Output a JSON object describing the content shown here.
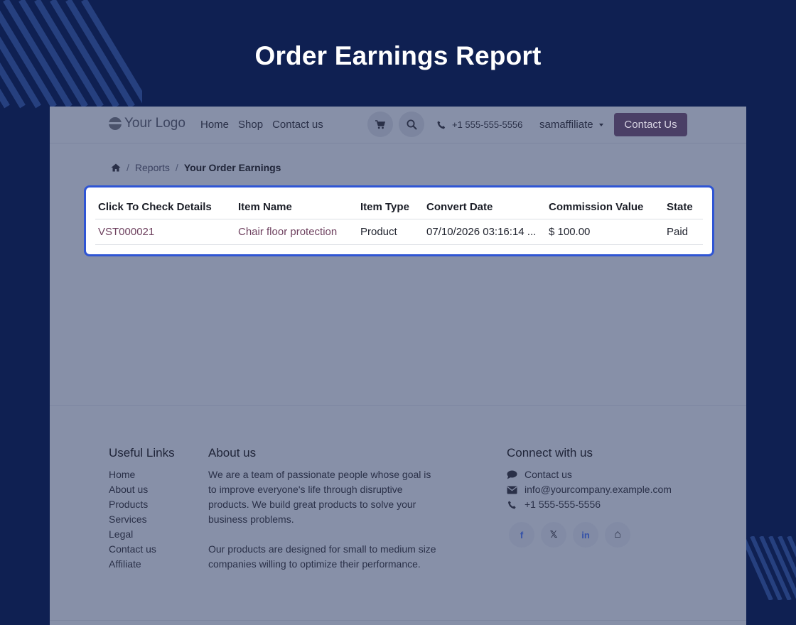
{
  "banner": {
    "title": "Order Earnings Report"
  },
  "navbar": {
    "logo": "Your Logo",
    "links": [
      "Home",
      "Shop",
      "Contact us"
    ],
    "phone": "+1 555-555-5556",
    "user": "samaffiliate",
    "contact_button": "Contact Us"
  },
  "breadcrumb": {
    "items": [
      "Reports"
    ],
    "active": "Your Order Earnings"
  },
  "table": {
    "headers": [
      "Click To Check Details",
      "Item Name",
      "Item Type",
      "Convert Date",
      "Commission Value",
      "State"
    ],
    "rows": [
      [
        "VST000021",
        "Chair floor protection",
        "Product",
        "07/10/2026 03:16:14 ...",
        "$ 100.00",
        "Paid"
      ]
    ]
  },
  "footer": {
    "useful_links": {
      "title": "Useful Links",
      "items": [
        "Home",
        "About us",
        "Products",
        "Services",
        "Legal",
        "Contact us",
        "Affiliate"
      ]
    },
    "about": {
      "title": "About us",
      "paragraphs": [
        "We are a team of passionate people whose goal is to improve everyone's life through disruptive products. We build great products to solve your business problems.",
        "Our products are designed for small to medium size companies willing to optimize their performance."
      ]
    },
    "connect": {
      "title": "Connect with us",
      "items": [
        {
          "icon": "comment-icon",
          "text": "Contact us"
        },
        {
          "icon": "envelope-icon",
          "text": "info@yourcompany.example.com"
        },
        {
          "icon": "phone-icon",
          "text": "+1 555-555-5556"
        }
      ],
      "social": [
        {
          "icon": "facebook-icon",
          "glyph": "f"
        },
        {
          "icon": "x-icon",
          "glyph": "𝕏"
        },
        {
          "icon": "linkedin-icon",
          "glyph": "in"
        },
        {
          "icon": "home-icon",
          "glyph": "⌂"
        }
      ]
    }
  },
  "colors": {
    "background": "#0f2052",
    "site_overlay": "#8790a8",
    "highlight": "#2f55d4",
    "contact_button": "#4a3f66"
  }
}
